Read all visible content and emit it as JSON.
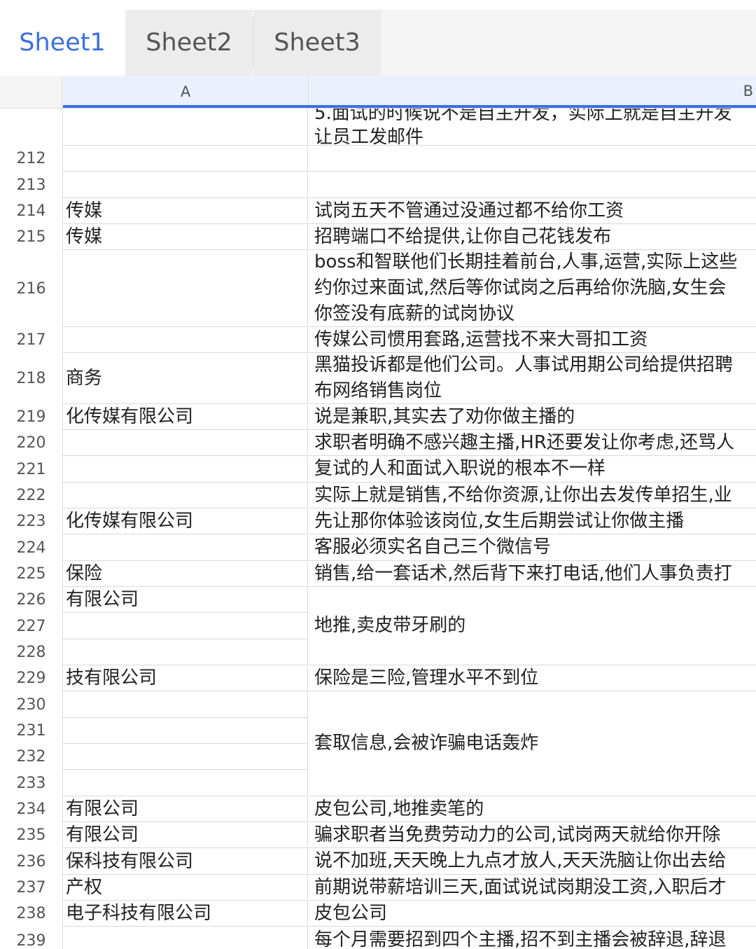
{
  "tabs": [
    "Sheet1",
    "Sheet2",
    "Sheet3"
  ],
  "columns": [
    "A",
    "B"
  ],
  "top_partial": {
    "b_lines": [
      "5.面试的时候说不是自主开发，实际上就是自主开发",
      "让员工发邮件"
    ]
  },
  "rows": [
    {
      "n": "212",
      "a": "",
      "b": []
    },
    {
      "n": "213",
      "a": "",
      "b": []
    },
    {
      "n": "214",
      "a": "传媒",
      "b": [
        "试岗五天不管通过没通过都不给你工资"
      ]
    },
    {
      "n": "215",
      "a": "传媒",
      "b": [
        "招聘端口不给提供,让你自己花钱发布"
      ]
    },
    {
      "n": "216",
      "a": "",
      "b": [
        "boss和智联他们长期挂着前台,人事,运营,实际上这些",
        "约你过来面试,然后等你试岗之后再给你洗脑,女生会",
        "你签没有底薪的试岗协议"
      ]
    },
    {
      "n": "217",
      "a": "",
      "b": [
        "传媒公司惯用套路,运营找不来大哥扣工资"
      ]
    },
    {
      "n": "218",
      "a": "商务",
      "b": [
        "黑猫投诉都是他们公司。人事试用期公司给提供招聘",
        "布网络销售岗位"
      ]
    },
    {
      "n": "219",
      "a": "化传媒有限公司",
      "b": [
        "说是兼职,其实去了劝你做主播的"
      ]
    },
    {
      "n": "220",
      "a": "",
      "b": [
        "求职者明确不感兴趣主播,HR还要发让你考虑,还骂人"
      ]
    },
    {
      "n": "221",
      "a": "",
      "b": [
        "复试的人和面试入职说的根本不一样"
      ]
    },
    {
      "n": "222",
      "a": "",
      "b": [
        "实际上就是销售,不给你资源,让你出去发传单招生,业"
      ]
    },
    {
      "n": "223",
      "a": "化传媒有限公司",
      "b": [
        "先让那你体验该岗位,女生后期尝试让你做主播"
      ]
    },
    {
      "n": "224",
      "a": "",
      "b": [
        "客服必须实名自己三个微信号"
      ]
    },
    {
      "n": "225",
      "a": "保险",
      "b": [
        "销售,给一套话术,然后背下来打电话,他们人事负责打"
      ]
    },
    {
      "n": "226",
      "a": "有限公司",
      "b": []
    },
    {
      "n": "227",
      "a": "",
      "b": []
    },
    {
      "n": "228",
      "a": "",
      "b": []
    },
    {
      "n": "229",
      "a": "技有限公司",
      "b": [
        "保险是三险,管理水平不到位"
      ]
    },
    {
      "n": "230",
      "a": "",
      "b": []
    },
    {
      "n": "231",
      "a": "",
      "b": []
    },
    {
      "n": "232",
      "a": "",
      "b": []
    },
    {
      "n": "233",
      "a": "",
      "b": []
    },
    {
      "n": "234",
      "a": "有限公司",
      "b": [
        "皮包公司,地推卖笔的"
      ]
    },
    {
      "n": "235",
      "a": "有限公司",
      "b": [
        "骗求职者当免费劳动力的公司,试岗两天就给你开除"
      ]
    },
    {
      "n": "236",
      "a": "保科技有限公司",
      "b": [
        "说不加班,天天晚上九点才放人,天天洗脑让你出去给"
      ]
    },
    {
      "n": "237",
      "a": "产权",
      "b": [
        "前期说带薪培训三天,面试说试岗期没工资,入职后才"
      ]
    },
    {
      "n": "238",
      "a": "电子科技有限公司",
      "b": [
        "皮包公司"
      ]
    },
    {
      "n": "239",
      "a": "",
      "b": [
        "每个月需要招到四个主播,招不到主播会被辞退,辞退"
      ]
    }
  ],
  "merged_b": [
    {
      "rows": "226-228",
      "text": "地推,卖皮带牙刷的"
    },
    {
      "rows": "230-233",
      "text": "套取信息,会被诈骗电话轰炸"
    }
  ],
  "colors": {
    "accent": "#3c6fe0",
    "grid": "#d9d9d9",
    "header_bg": "#f5f5f5"
  }
}
